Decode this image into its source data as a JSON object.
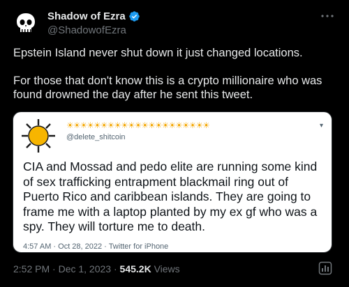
{
  "tweet": {
    "author_name": "Shadow of Ezra",
    "author_handle": "@ShadowofEzra",
    "more_icon": "more-icon",
    "text_paragraphs": [
      "Epstein Island never shut down it just changed locations.",
      "For those that don't know this is a crypto millionaire who was found drowned the day after he sent this tweet."
    ],
    "timestamp": "2:52 PM · Dec 1, 2023",
    "separator": "·",
    "views_count": "545.2K",
    "views_label": "Views",
    "analytics_icon": "analytics-icon"
  },
  "embedded_tweet": {
    "header_emoji": "☀☀☀☀☀☀☀☀☀☀☀☀☀☀☀☀☀☀☀☀☀",
    "handle": "@delete_shitcoin",
    "text": "CIA and Mossad and pedo elite are running some kind of sex trafficking entrapment blackmail ring out of Puerto Rico and caribbean islands. They are going to frame me with a laptop planted by my ex gf who was a spy. They will torture me to death.",
    "meta": "4:57 AM · Oct 28, 2022 · Twitter for iPhone"
  },
  "colors": {
    "background": "#000000",
    "primary_text": "#e7e9ea",
    "secondary_text": "#71767b",
    "verified": "#1d9bf0",
    "embed_bg": "#ffffff"
  }
}
